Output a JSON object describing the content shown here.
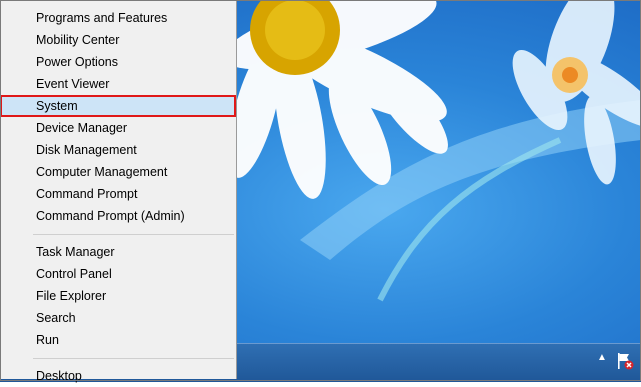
{
  "menu": {
    "group1": [
      {
        "label": "Programs and Features"
      },
      {
        "label": "Mobility Center"
      },
      {
        "label": "Power Options"
      },
      {
        "label": "Event Viewer"
      },
      {
        "label": "System",
        "highlighted": true
      },
      {
        "label": "Device Manager"
      },
      {
        "label": "Disk Management"
      },
      {
        "label": "Computer Management"
      },
      {
        "label": "Command Prompt"
      },
      {
        "label": "Command Prompt (Admin)"
      }
    ],
    "group2": [
      {
        "label": "Task Manager"
      },
      {
        "label": "Control Panel"
      },
      {
        "label": "File Explorer"
      },
      {
        "label": "Search"
      },
      {
        "label": "Run"
      }
    ],
    "group3": [
      {
        "label": "Desktop"
      }
    ]
  },
  "taskbar": {
    "tray_chevron_icon": "chevron-up-icon",
    "action_center_icon": "flag-with-x-icon"
  },
  "colors": {
    "menu_bg": "#f0f0f0",
    "highlight": "#cde4f7",
    "annotation_box": "#e01818",
    "wallpaper": "#2a84d8"
  }
}
